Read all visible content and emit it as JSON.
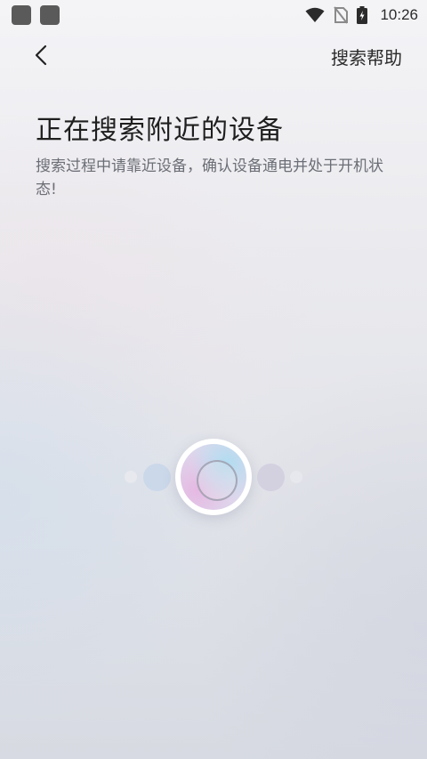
{
  "status_bar": {
    "time": "10:26",
    "icons": [
      "app-notification-icon",
      "app-notification-icon",
      "wifi-icon",
      "no-sim-icon",
      "battery-charging-icon"
    ]
  },
  "nav": {
    "back_icon": "chevron-left-icon",
    "help_label": "搜索帮助"
  },
  "main": {
    "title": "正在搜索附近的设备",
    "subtitle": "搜索过程中请靠近设备，确认设备通电并处于开机状态!"
  },
  "scan_animation": {
    "icon": "scanning-orb-icon"
  }
}
